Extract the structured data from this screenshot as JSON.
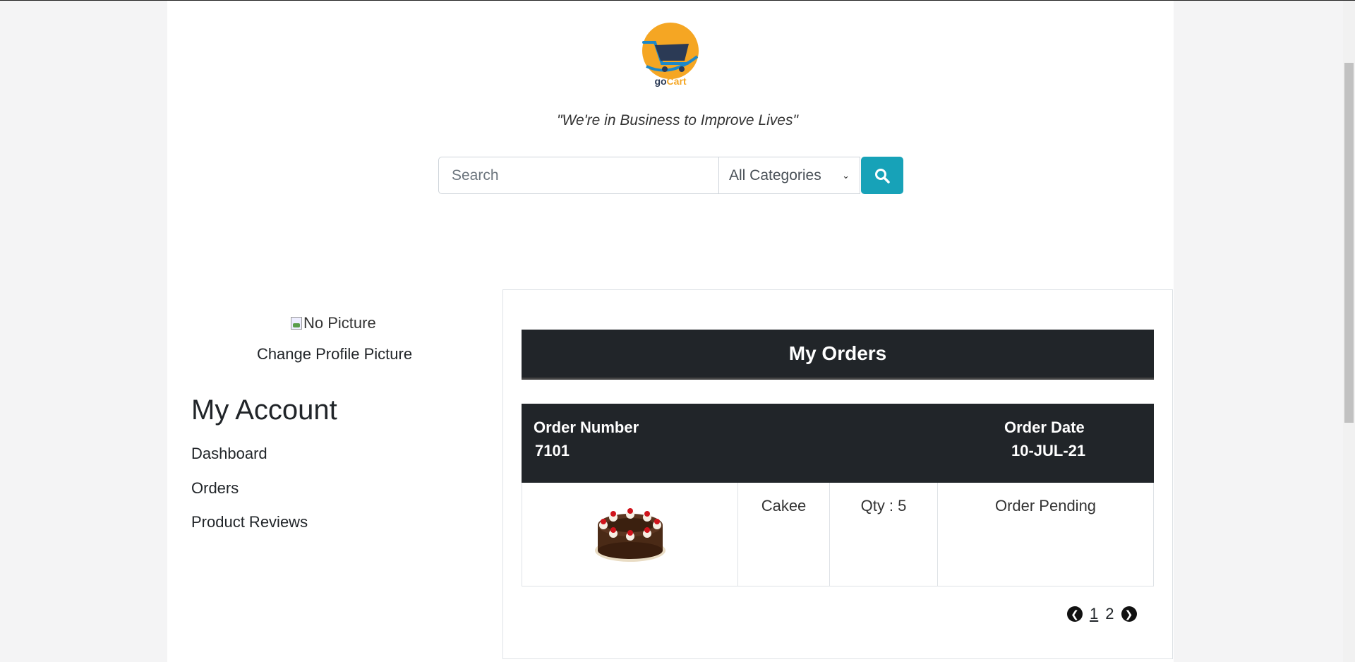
{
  "brand": {
    "logo_text": "goCart",
    "tagline": "\"We're in Business to Improve Lives\""
  },
  "search": {
    "placeholder": "Search",
    "category_selected": "All Categories"
  },
  "profile": {
    "picture_alt": "No Picture",
    "change_label": "Change Profile Picture"
  },
  "sidebar": {
    "title": "My Account",
    "items": [
      {
        "label": "Dashboard"
      },
      {
        "label": "Orders"
      },
      {
        "label": "Product Reviews"
      }
    ]
  },
  "orders": {
    "title": "My Orders",
    "order_number_label": "Order Number",
    "order_number": "7101",
    "order_date_label": "Order Date",
    "order_date": "10-JUL-21",
    "items": [
      {
        "name": "Cakee",
        "qty": "Qty : 5",
        "status": "Order Pending"
      }
    ]
  },
  "pagination": {
    "pages": [
      "1",
      "2"
    ],
    "current": "1"
  },
  "colors": {
    "accent": "#17a2b8",
    "dark": "#212529",
    "logo_orange": "#f5a623"
  }
}
